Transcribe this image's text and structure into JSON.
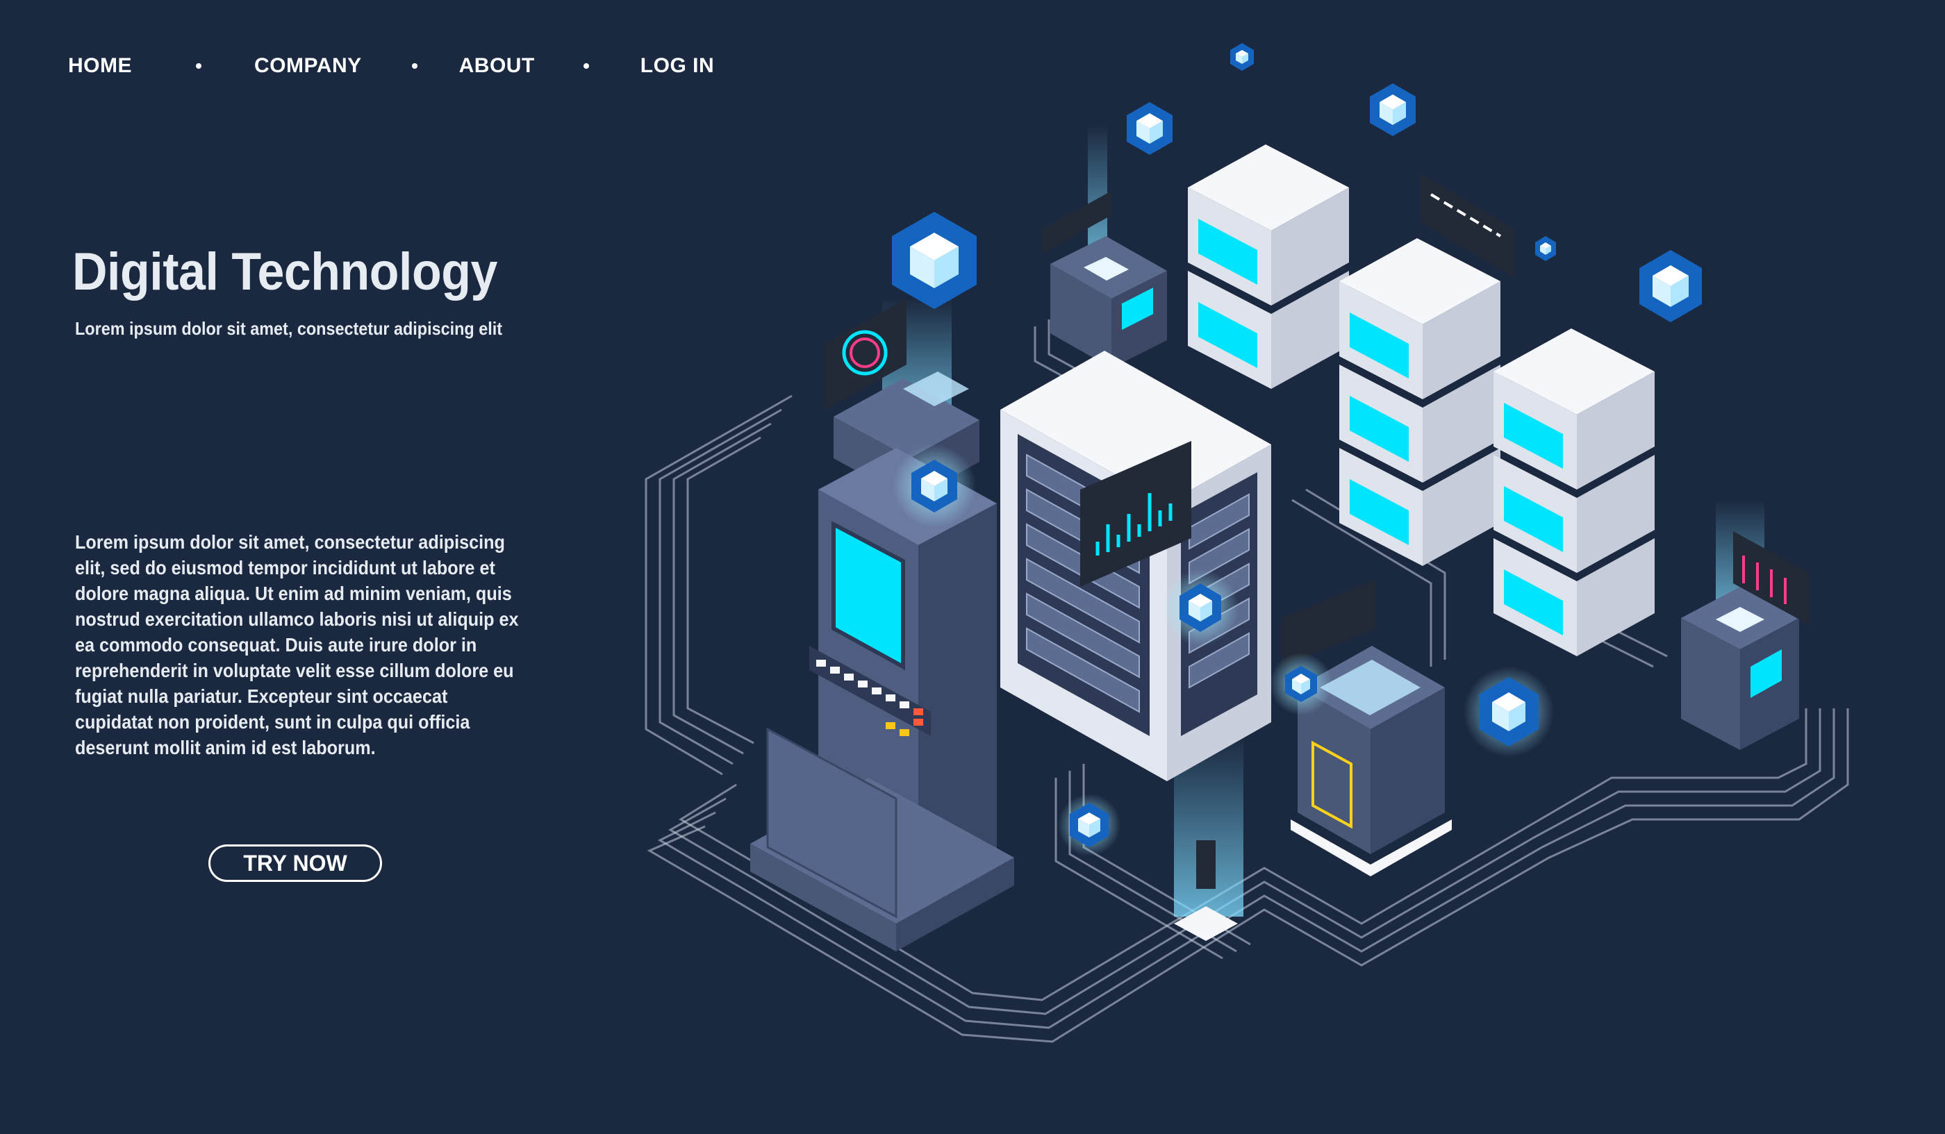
{
  "nav": {
    "items": [
      {
        "label": "HOME"
      },
      {
        "label": "COMPANY"
      },
      {
        "label": "ABOUT"
      },
      {
        "label": "LOG IN"
      }
    ]
  },
  "hero": {
    "title": "Digital Technology",
    "subtitle": "Lorem ipsum dolor sit amet, consectetur adipiscing elit",
    "body": "Lorem ipsum dolor sit amet, consectetur adipiscing elit, sed do eiusmod tempor incididunt ut labore et dolore magna aliqua. Ut enim ad minim veniam, quis nostrud exercitation ullamco laboris nisi ut aliquip ex ea commodo consequat. Duis aute irure dolor in reprehenderit in voluptate velit esse cillum dolore eu fugiat nulla pariatur. Excepteur sint occaecat cupidatat non proident, sunt in culpa qui officia deserunt mollit anim id est laborum.",
    "cta_label": "TRY NOW"
  },
  "colors": {
    "background": "#1b2940",
    "accent_cyan": "#00e5ff",
    "hex_blue": "#1565c0",
    "server_white": "#eef0f6",
    "machine_slate": "#4a5877"
  },
  "illustration": {
    "icons": [
      "isometric-server-cluster",
      "control-terminal",
      "server-rack",
      "data-cubes",
      "hologram-screens",
      "circuit-lines"
    ]
  }
}
